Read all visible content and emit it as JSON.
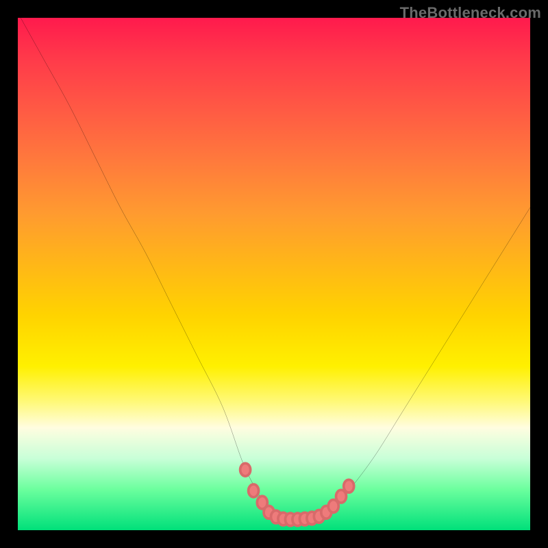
{
  "watermark": "TheBottleneck.com",
  "colors": {
    "frame_border": "#000000",
    "curve_stroke": "#000000",
    "marker_fill": "#ee7b7b",
    "gradient_top": "#ff1a4d",
    "gradient_bottom": "#00e07a"
  },
  "chart_data": {
    "type": "line",
    "title": "",
    "xlabel": "",
    "ylabel": "",
    "xlim": [
      0,
      100
    ],
    "ylim": [
      0,
      100
    ],
    "grid": false,
    "legend": false,
    "series": [
      {
        "name": "bottleneck-curve",
        "x": [
          0,
          5,
          10,
          15,
          20,
          25,
          30,
          35,
          40,
          44,
          47,
          49,
          51,
          53,
          55,
          58,
          60,
          63,
          66,
          70,
          75,
          80,
          85,
          90,
          95,
          100
        ],
        "y": [
          101,
          92,
          83,
          73,
          63,
          54,
          44,
          34,
          24,
          13,
          7,
          3.5,
          2.3,
          2.1,
          2.1,
          2.4,
          3.5,
          6,
          9.5,
          15,
          23,
          31,
          39,
          47,
          55,
          63
        ]
      }
    ],
    "markers": [
      {
        "x": 44.4,
        "y": 11.8
      },
      {
        "x": 46.0,
        "y": 7.7
      },
      {
        "x": 47.7,
        "y": 5.4
      },
      {
        "x": 49.0,
        "y": 3.5
      },
      {
        "x": 50.4,
        "y": 2.6
      },
      {
        "x": 51.8,
        "y": 2.2
      },
      {
        "x": 53.2,
        "y": 2.1
      },
      {
        "x": 54.6,
        "y": 2.1
      },
      {
        "x": 56.0,
        "y": 2.2
      },
      {
        "x": 57.4,
        "y": 2.35
      },
      {
        "x": 58.8,
        "y": 2.7
      },
      {
        "x": 60.2,
        "y": 3.5
      },
      {
        "x": 61.6,
        "y": 4.7
      },
      {
        "x": 63.1,
        "y": 6.6
      },
      {
        "x": 64.6,
        "y": 8.6
      }
    ]
  }
}
